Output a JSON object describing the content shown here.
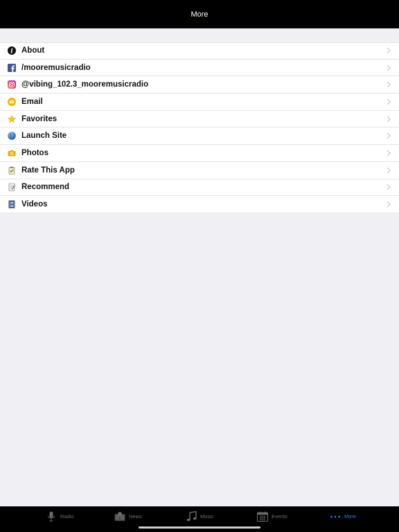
{
  "navbar": {
    "title": "More"
  },
  "menu": {
    "items": [
      {
        "label": "About",
        "icon": "info-icon"
      },
      {
        "label": "/mooremusicradio",
        "icon": "facebook-icon"
      },
      {
        "label": "@vibing_102.3_mooremusicradio",
        "icon": "instagram-icon"
      },
      {
        "label": "Email",
        "icon": "email-icon"
      },
      {
        "label": "Favorites",
        "icon": "star-icon"
      },
      {
        "label": "Launch Site",
        "icon": "globe-icon"
      },
      {
        "label": "Photos",
        "icon": "camera-icon"
      },
      {
        "label": "Rate This App",
        "icon": "clipboard-check-icon"
      },
      {
        "label": "Recommend",
        "icon": "notepad-icon"
      },
      {
        "label": "Videos",
        "icon": "film-icon"
      }
    ]
  },
  "tabbar": {
    "tabs": [
      {
        "label": "Radio",
        "icon": "microphone-icon"
      },
      {
        "label": "News",
        "icon": "newspaper-icon"
      },
      {
        "label": "Music",
        "icon": "music-note-icon"
      },
      {
        "label": "Events",
        "icon": "calendar-icon"
      },
      {
        "label": "More",
        "icon": "more-dots-icon",
        "active": true
      }
    ]
  },
  "colors": {
    "accent": "#2f7bd8",
    "navbar_bg": "#000000",
    "page_bg": "#efeff4"
  }
}
